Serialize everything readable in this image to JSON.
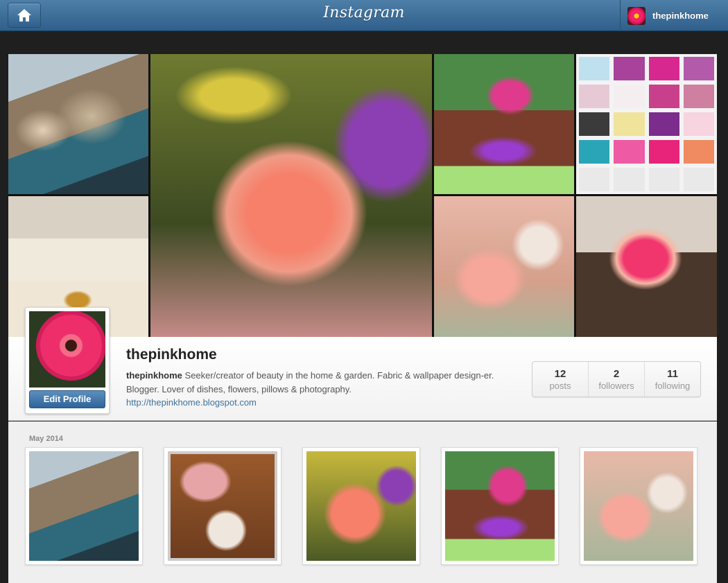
{
  "header": {
    "brand": "Instagram",
    "username": "thepinkhome",
    "accent": "#3f729b"
  },
  "mosaic": {
    "tiles": [
      "seashells",
      "coral carnation",
      "pink chair",
      "wallpaper swatches",
      "vases",
      "roses",
      "gerbera daisies"
    ]
  },
  "profile": {
    "username": "thepinkhome",
    "bio_name": "thepinkhome",
    "bio_text": "Seeker/creator of beauty in the home & garden. Fabric & wallpaper design-er. Blogger. Lover of dishes, flowers, pillows & photography.",
    "website": "http://thepinkhome.blogspot.com",
    "edit_label": "Edit Profile"
  },
  "stats": [
    {
      "value": "12",
      "label": "posts"
    },
    {
      "value": "2",
      "label": "followers"
    },
    {
      "value": "11",
      "label": "following"
    }
  ],
  "feed": {
    "month": "May 2014",
    "photos": [
      "seashells",
      "cat and bag",
      "carnation",
      "pink chair",
      "roses"
    ]
  }
}
